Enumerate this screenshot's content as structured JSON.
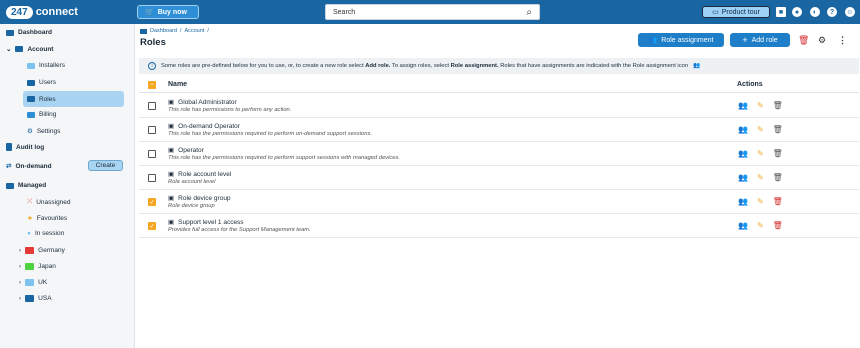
{
  "app": {
    "logo_number": "247",
    "logo_text": "connect",
    "buy_now": "Buy now",
    "search_placeholder": "Search",
    "product_tour": "Product tour"
  },
  "sidebar": {
    "dashboard": "Dashboard",
    "account": "Account",
    "installers": "Installers",
    "users": "Users",
    "roles": "Roles",
    "billing": "Billing",
    "settings": "Settings",
    "audit_log": "Audit log",
    "on_demand": "On-demand",
    "create": "Create",
    "managed": "Managed",
    "unassigned": "Unassigned",
    "favourites": "Favourites",
    "in_session": "In session",
    "groups": [
      {
        "label": "Germany",
        "color": "#e53935"
      },
      {
        "label": "Japan",
        "color": "#4cd33d"
      },
      {
        "label": "UK",
        "color": "#7cc3ef"
      },
      {
        "label": "USA",
        "color": "#1966a3"
      }
    ]
  },
  "main": {
    "crumb_dashboard": "Dashboard",
    "crumb_account": "Account",
    "crumb_sep1": "/",
    "crumb_sep2": "/",
    "title": "Roles",
    "role_assignment": "Role assignment",
    "add_role": "Add role",
    "info_text_1": "Some roles are pre-defined below for you to use, or, to create a new role select ",
    "info_add_role": "Add role.",
    "info_text_2": " To assign roles, select ",
    "info_role_assignment": "Role assignment.",
    "info_text_3": " Roles that have assignments are indicated with the Role assignment icon",
    "col_name": "Name",
    "col_actions": "Actions",
    "rows": [
      {
        "name": "Global Administrator",
        "desc": "This role has permissions to perform any action.",
        "checked": false
      },
      {
        "name": "On-demand Operator",
        "desc": "This role has the permissions required to perform on-demand support sessions.",
        "checked": false
      },
      {
        "name": "Operator",
        "desc": "This role has the permissions required to perform support sessions with managed devices.",
        "checked": false
      },
      {
        "name": "Role account level",
        "desc": "Role account level",
        "checked": false
      },
      {
        "name": "Role device group",
        "desc": "Role device group",
        "checked": true
      },
      {
        "name": "Support level 1 access",
        "desc": "Provides full access for the Support Management team.",
        "checked": true
      }
    ]
  },
  "colors": {
    "brand": "#1966a3",
    "accent": "#f5a623",
    "danger": "#d32f2f"
  }
}
